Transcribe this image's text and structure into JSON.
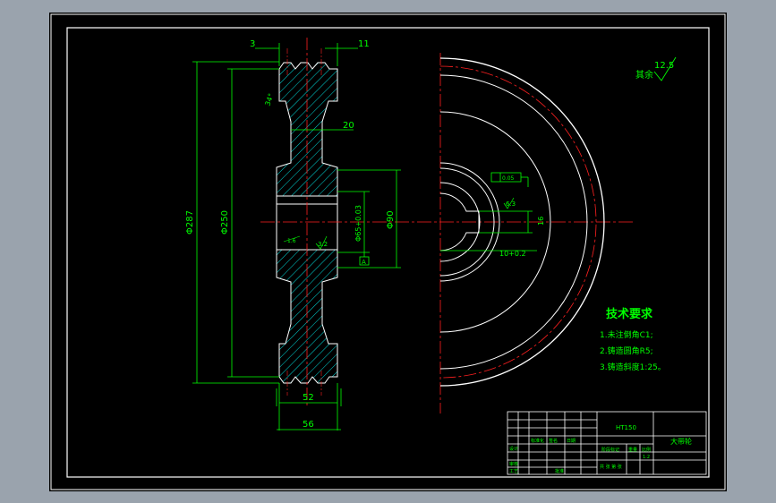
{
  "colors": {
    "outline": "#ffffff",
    "dimension": "#00ff00",
    "centerline": "#ff2020",
    "hatch": "#00e5e5",
    "text": "#00ff00",
    "background": "#000000",
    "window_bg": "#9aa3ad"
  },
  "side_view": {
    "dim_top_left": "3",
    "dim_top_right": "11",
    "dim_groove_angle": "34°",
    "dim_web": "20",
    "dim_outer_dia": "Φ287",
    "dim_pitch_dia": "Φ250",
    "dim_bore_fit": "Φ65+0.03",
    "dim_hub_dia": "Φ90",
    "dim_chamfer": "1.6",
    "dim_bore_rough": "3.2",
    "dim_datum": "A",
    "dim_width_inner": "52",
    "dim_width_outer": "56"
  },
  "front_view": {
    "tol_frame": "0.05",
    "dim_keyway_rough": "6.3",
    "dim_keyway_depth": "16",
    "dim_keyway_width": "10+0.2"
  },
  "roughness_note": {
    "label": "其余",
    "value": "12.5"
  },
  "requirements": {
    "title": "技术要求",
    "items": [
      "1.未注倒角C1;",
      "2.铸造圆角R5;",
      "3.铸造斜度1:25。"
    ]
  },
  "title_block": {
    "material": "HT150",
    "part_name": "大带轮",
    "scale_label": "比例",
    "scale": "1:2",
    "sheet": "共 张 第 张",
    "designer_label": "设计",
    "reviewer_label": "审核",
    "process_label": "工艺",
    "approve_label": "批准",
    "std_label": "标准化",
    "sign_label": "签名",
    "date_label": "日期",
    "stage_label": "阶段标记",
    "weight_label": "重量"
  }
}
